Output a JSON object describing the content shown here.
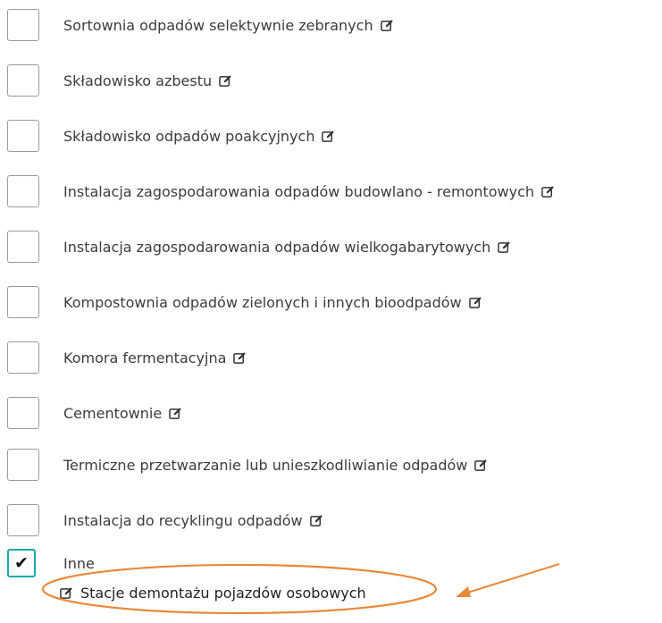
{
  "items": [
    {
      "label": "Sortownia odpadów selektywnie zebranych",
      "checked": false
    },
    {
      "label": "Składowisko azbestu",
      "checked": false
    },
    {
      "label": "Składowisko odpadów poakcyjnych",
      "checked": false
    },
    {
      "label": "Instalacja zagospodarowania odpadów budowlano - remontowych",
      "checked": false
    },
    {
      "label": "Instalacja zagospodarowania odpadów wielkogabarytowych",
      "checked": false
    },
    {
      "label": "Kompostownia odpadów zielonych i innych bioodpadów",
      "checked": false
    },
    {
      "label": "Komora fermentacyjna",
      "checked": false
    },
    {
      "label": "Cementownie",
      "checked": false
    },
    {
      "label": "Termiczne przetwarzanie lub unieszkodliwianie odpadów",
      "checked": false
    },
    {
      "label": "Instalacja do recyklingu odpadów",
      "checked": false
    },
    {
      "label": "Inne",
      "checked": true
    }
  ],
  "other_entry": {
    "label": "Stacje demontażu pojazdów osobowych"
  },
  "icons": {
    "edit": "edit-icon",
    "check": "checkmark-icon"
  },
  "colors": {
    "checked_border": "#1aa9a9",
    "annotation": "#e8893a"
  }
}
